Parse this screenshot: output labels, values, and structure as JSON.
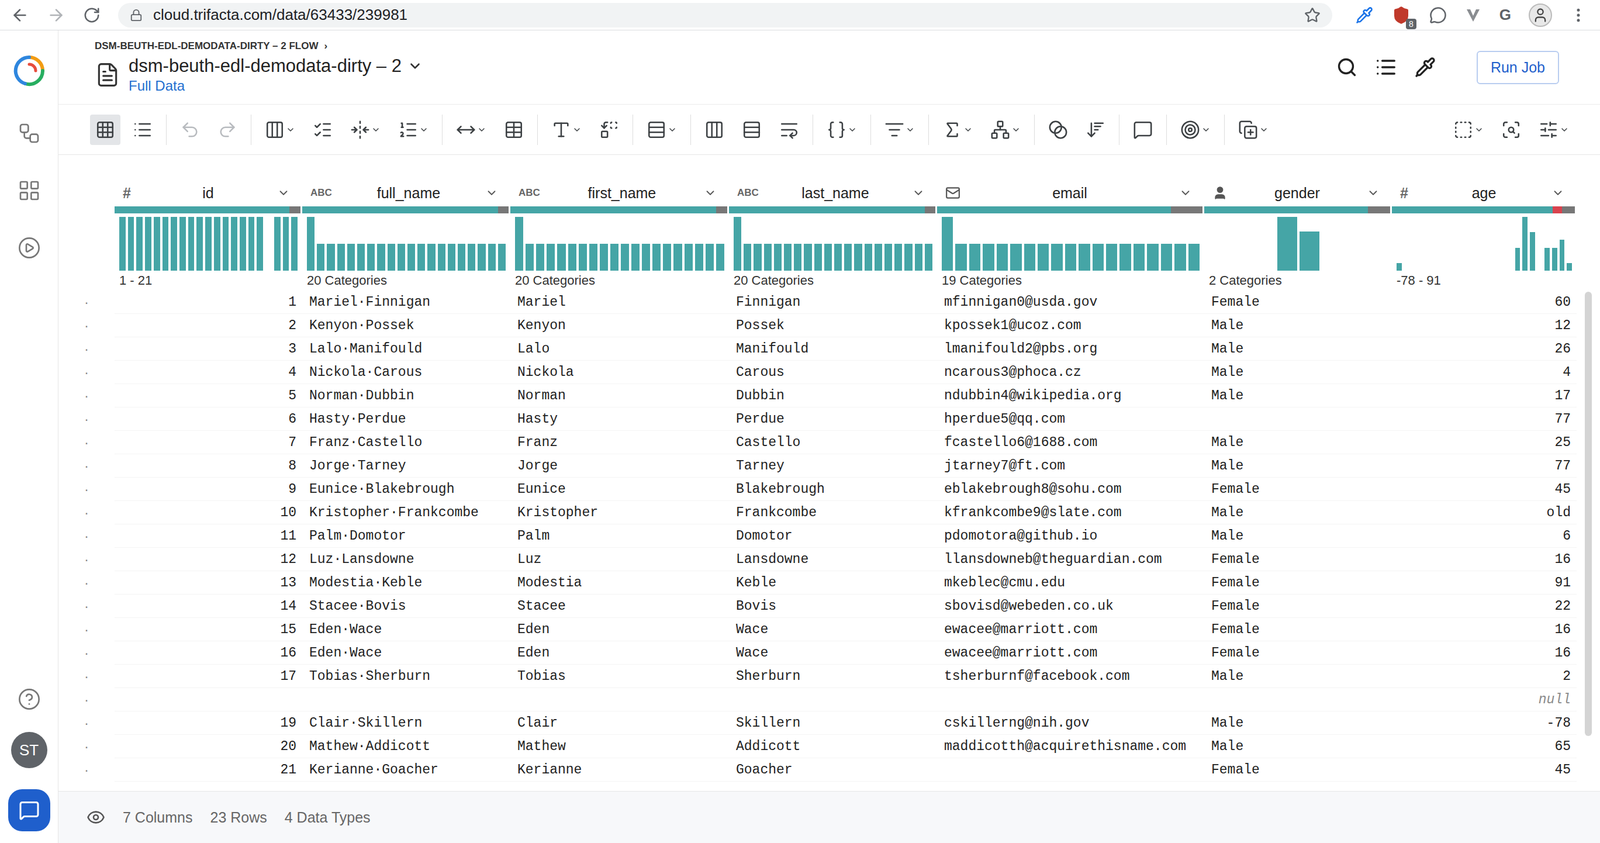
{
  "browser": {
    "url": "cloud.trifacta.com/data/63433/239981",
    "extension_badge": "8",
    "extension_letter": "G"
  },
  "sidebar": {
    "avatar": "ST"
  },
  "header": {
    "breadcrumb": "DSM-BEUTH-EDL-DEMODATA-DIRTY – 2 FLOW",
    "breadcrumb_arrow": "›",
    "title": "dsm-beuth-edl-demodata-dirty – 2",
    "sample": "Full Data",
    "run_button": "Run Job"
  },
  "toolbar": {
    "views": [
      {
        "selected": true
      },
      {
        "selected": false
      }
    ],
    "history": [
      {
        "disabled": true
      },
      {
        "disabled": true
      }
    ]
  },
  "table": {
    "row_marker": "·",
    "columns": [
      {
        "name": "id",
        "type_kind": "integer",
        "type_label": "#",
        "summary": "1 - 21",
        "quality": {
          "valid": 0.94,
          "mismatched": 0,
          "missing": 0.06
        },
        "histogram": [
          1,
          1,
          1,
          1,
          1,
          1,
          1,
          1,
          1,
          1,
          1,
          1,
          1,
          1,
          1,
          1,
          1,
          0,
          1,
          1,
          1
        ]
      },
      {
        "name": "full_name",
        "type_kind": "string",
        "type_label": "ABC",
        "summary": "20 Categories",
        "quality": {
          "valid": 0.95,
          "mismatched": 0,
          "missing": 0.05
        },
        "histogram": [
          2,
          1,
          1,
          1,
          1,
          1,
          1,
          1,
          1,
          1,
          1,
          1,
          1,
          1,
          1,
          1,
          1,
          1,
          1,
          1
        ]
      },
      {
        "name": "first_name",
        "type_kind": "string",
        "type_label": "ABC",
        "summary": "20 Categories",
        "quality": {
          "valid": 0.95,
          "mismatched": 0,
          "missing": 0.05
        },
        "histogram": [
          2,
          1,
          1,
          1,
          1,
          1,
          1,
          1,
          1,
          1,
          1,
          1,
          1,
          1,
          1,
          1,
          1,
          1,
          1,
          1
        ]
      },
      {
        "name": "last_name",
        "type_kind": "string",
        "type_label": "ABC",
        "summary": "20 Categories",
        "quality": {
          "valid": 0.95,
          "mismatched": 0,
          "missing": 0.05
        },
        "histogram": [
          2,
          1,
          1,
          1,
          1,
          1,
          1,
          1,
          1,
          1,
          1,
          1,
          1,
          1,
          1,
          1,
          1,
          1,
          1,
          1
        ]
      },
      {
        "name": "email",
        "type_kind": "email",
        "type_label": "",
        "summary": "19 Categories",
        "quality": {
          "valid": 0.88,
          "mismatched": 0,
          "missing": 0.12
        },
        "histogram": [
          2,
          1,
          1,
          1,
          1,
          1,
          1,
          1,
          1,
          1,
          1,
          1,
          1,
          1,
          1,
          1,
          1,
          1,
          1
        ]
      },
      {
        "name": "gender",
        "type_kind": "gender",
        "type_label": "",
        "summary": "2 Categories",
        "quality": {
          "valid": 0.88,
          "mismatched": 0,
          "missing": 0.12
        },
        "histogram": [
          11,
          8
        ]
      },
      {
        "name": "age",
        "type_kind": "integer",
        "type_label": "#",
        "summary": "-78 - 91",
        "quality": {
          "valid": 0.88,
          "mismatched": 0.05,
          "missing": 0.07
        },
        "histogram": [
          1,
          0,
          0,
          0,
          0,
          0,
          0,
          0,
          0,
          0,
          0,
          0,
          0,
          0,
          0,
          0,
          3,
          7,
          5,
          0,
          3,
          3,
          4,
          1
        ]
      }
    ],
    "rows": [
      {
        "cells": [
          "1",
          "Mariel·Finnigan",
          "Mariel",
          "Finnigan",
          "mfinnigan0@usda.gov",
          "Female",
          "60"
        ],
        "nulls": []
      },
      {
        "cells": [
          "2",
          "Kenyon·Possek",
          "Kenyon",
          "Possek",
          "kpossek1@ucoz.com",
          "Male",
          "12"
        ],
        "nulls": []
      },
      {
        "cells": [
          "3",
          "Lalo·Manifould",
          "Lalo",
          "Manifould",
          "lmanifould2@pbs.org",
          "Male",
          "26"
        ],
        "nulls": []
      },
      {
        "cells": [
          "4",
          "Nickola·Carous",
          "Nickola",
          "Carous",
          "ncarous3@phoca.cz",
          "Male",
          "4"
        ],
        "nulls": []
      },
      {
        "cells": [
          "5",
          "Norman·Dubbin",
          "Norman",
          "Dubbin",
          "ndubbin4@wikipedia.org",
          "Male",
          "17"
        ],
        "nulls": []
      },
      {
        "cells": [
          "6",
          "Hasty·Perdue",
          "Hasty",
          "Perdue",
          "hperdue5@qq.com",
          "",
          "77"
        ],
        "nulls": []
      },
      {
        "cells": [
          "7",
          "Franz·Castello",
          "Franz",
          "Castello",
          "fcastello6@1688.com",
          "Male",
          "25"
        ],
        "nulls": []
      },
      {
        "cells": [
          "8",
          "Jorge·Tarney",
          "Jorge",
          "Tarney",
          "jtarney7@ft.com",
          "Male",
          "77"
        ],
        "nulls": []
      },
      {
        "cells": [
          "9",
          "Eunice·Blakebrough",
          "Eunice",
          "Blakebrough",
          "eblakebrough8@sohu.com",
          "Female",
          "45"
        ],
        "nulls": []
      },
      {
        "cells": [
          "10",
          "Kristopher·Frankcombe",
          "Kristopher",
          "Frankcombe",
          "kfrankcombe9@slate.com",
          "Male",
          "old"
        ],
        "nulls": []
      },
      {
        "cells": [
          "11",
          "Palm·Domotor",
          "Palm",
          "Domotor",
          "pdomotora@github.io",
          "Male",
          "6"
        ],
        "nulls": []
      },
      {
        "cells": [
          "12",
          "Luz·Lansdowne",
          "Luz",
          "Lansdowne",
          "llansdowneb@theguardian.com",
          "Female",
          "16"
        ],
        "nulls": []
      },
      {
        "cells": [
          "13",
          "Modestia·Keble",
          "Modestia",
          "Keble",
          "mkeblec@cmu.edu",
          "Female",
          "91"
        ],
        "nulls": []
      },
      {
        "cells": [
          "14",
          "Stacee·Bovis",
          "Stacee",
          "Bovis",
          "sbovisd@webeden.co.uk",
          "Female",
          "22"
        ],
        "nulls": []
      },
      {
        "cells": [
          "15",
          "Eden·Wace",
          "Eden",
          "Wace",
          "ewacee@marriott.com",
          "Female",
          "16"
        ],
        "nulls": []
      },
      {
        "cells": [
          "16",
          "Eden·Wace",
          "Eden",
          "Wace",
          "ewacee@marriott.com",
          "Female",
          "16"
        ],
        "nulls": []
      },
      {
        "cells": [
          "17",
          "Tobias·Sherburn",
          "Tobias",
          "Sherburn",
          "tsherburnf@facebook.com",
          "Male",
          "2"
        ],
        "nulls": []
      },
      {
        "cells": [
          "",
          "",
          "",
          "",
          "",
          "",
          "null"
        ],
        "nulls": [
          6
        ]
      },
      {
        "cells": [
          "19",
          "Clair·Skillern",
          "Clair",
          "Skillern",
          "cskillerng@nih.gov",
          "Male",
          "-78"
        ],
        "nulls": []
      },
      {
        "cells": [
          "20",
          "Mathew·Addicott",
          "Mathew",
          "Addicott",
          "maddicotth@acquirethisname.com",
          "Male",
          "65"
        ],
        "nulls": []
      },
      {
        "cells": [
          "21",
          "Kerianne·Goacher",
          "Kerianne",
          "Goacher",
          "",
          "Female",
          "45"
        ],
        "nulls": []
      }
    ]
  },
  "status_bar": {
    "columns": "7 Columns",
    "rows": "23 Rows",
    "types": "4 Data Types"
  }
}
